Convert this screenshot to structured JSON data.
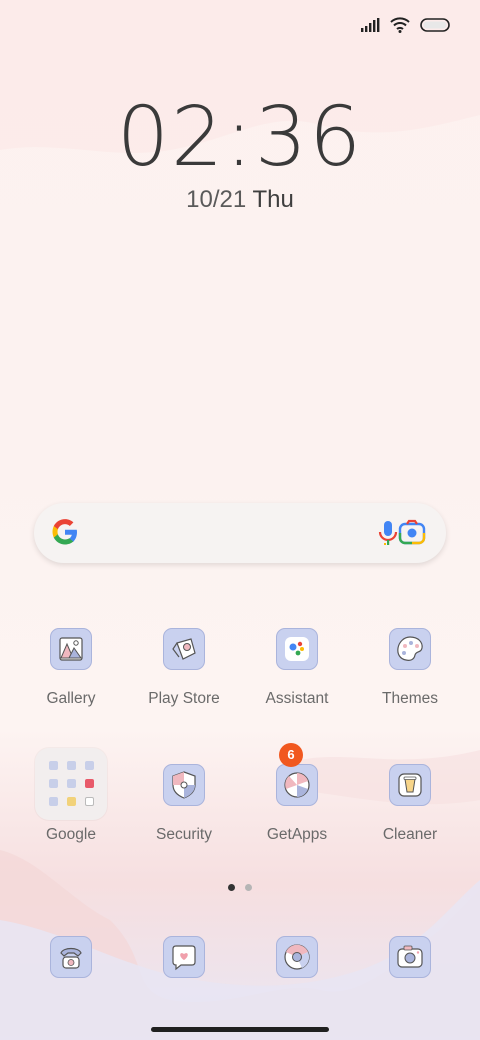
{
  "status_bar": {
    "signal_icon": "signal-icon",
    "wifi_icon": "wifi-icon",
    "battery_icon": "battery-icon"
  },
  "clock": {
    "time": "02:36",
    "date": "10/21",
    "weekday": "Thu"
  },
  "search_widget": {
    "google_icon": "google-g-icon",
    "mic_icon": "mic-icon",
    "lens_icon": "camera-lens-icon"
  },
  "row1": [
    {
      "label": "Gallery",
      "icon": "gallery-icon"
    },
    {
      "label": "Play Store",
      "icon": "play-store-icon"
    },
    {
      "label": "Assistant",
      "icon": "assistant-icon"
    },
    {
      "label": "Themes",
      "icon": "themes-icon"
    }
  ],
  "row2": [
    {
      "label": "Google",
      "icon": "folder-icon"
    },
    {
      "label": "Security",
      "icon": "security-icon"
    },
    {
      "label": "GetApps",
      "icon": "getapps-icon",
      "badge": "6"
    },
    {
      "label": "Cleaner",
      "icon": "cleaner-icon"
    }
  ],
  "dock": [
    {
      "icon": "phone-icon"
    },
    {
      "icon": "messages-icon"
    },
    {
      "icon": "browser-icon"
    },
    {
      "icon": "camera-icon"
    }
  ],
  "page_indicator": {
    "count": 2,
    "active": 0
  },
  "colors": {
    "badge": "#f1581f",
    "icon_bg": "#c9d1ef",
    "text": "#6a6a6a"
  }
}
